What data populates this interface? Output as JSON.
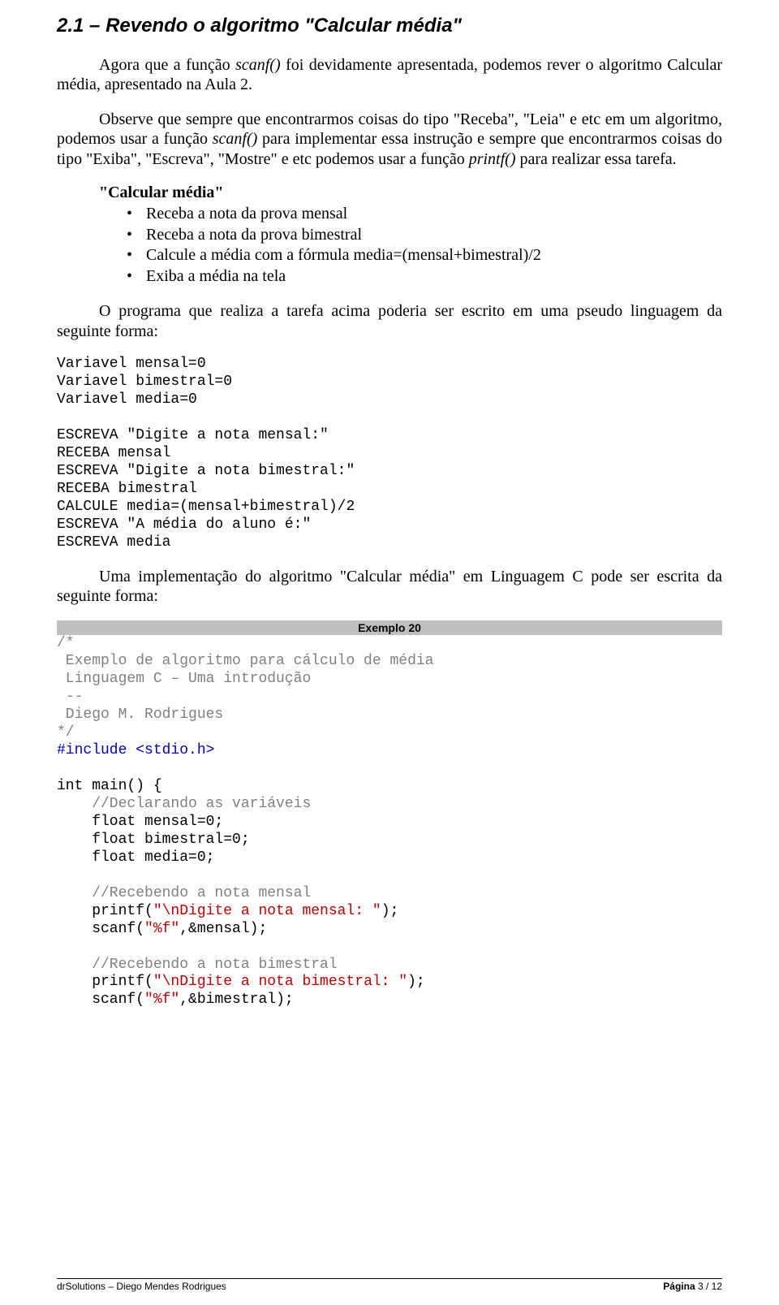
{
  "section": {
    "number": "2.1",
    "title": "Revendo o algoritmo \"Calcular média\""
  },
  "p1_a": "Agora que a função ",
  "p1_fn": "scanf()",
  "p1_b": " foi devidamente apresentada, podemos rever o algoritmo Calcular média, apresentado na Aula 2.",
  "p2_a": "Observe que sempre que encontrarmos coisas do tipo \"Receba\", \"Leia\" e etc em um algoritmo, podemos usar a função ",
  "p2_fn1": "scanf()",
  "p2_b": " para implementar essa instrução e sempre que encontrarmos coisas do tipo \"Exiba\", \"Escreva\", \"Mostre\" e etc podemos usar a função ",
  "p2_fn2": "printf()",
  "p2_c": " para realizar essa tarefa.",
  "algo_title": "\"Calcular média\"",
  "bullets": {
    "b1": "Receba a nota da prova mensal",
    "b2": "Receba a nota da prova bimestral",
    "b3": "Calcule a média com a fórmula media=(mensal+bimestral)/2",
    "b4": "Exiba a média na tela"
  },
  "p3": "O programa que realiza a tarefa acima poderia ser escrito em uma pseudo linguagem da seguinte forma:",
  "pseudo": {
    "l1": "Variavel mensal=0",
    "l2": "Variavel bimestral=0",
    "l3": "Variavel media=0",
    "l4": "ESCREVA \"Digite a nota mensal:\"",
    "l5": "RECEBA mensal",
    "l6": "ESCREVA \"Digite a nota bimestral:\"",
    "l7": "RECEBA bimestral",
    "l8": "CALCULE media=(mensal+bimestral)/2",
    "l9": "ESCREVA \"A média do aluno é:\"",
    "l10": "ESCREVA media"
  },
  "p4": "Uma implementação do algoritmo \"Calcular média\" em Linguagem C pode ser escrita da seguinte forma:",
  "example_label": "Exemplo 20",
  "code": {
    "c1": "/*",
    "c2": " Exemplo de algoritmo para cálculo de média",
    "c3": " Linguagem C – Uma introdução",
    "c4": " --",
    "c5": " Diego M. Rodrigues",
    "c6": "*/",
    "c7": "#include <stdio.h>",
    "c8": "int main() {",
    "c9": "    //Declarando as variáveis",
    "c10": "    float mensal=0;",
    "c11": "    float bimestral=0;",
    "c12": "    float media=0;",
    "c13": "    //Recebendo a nota mensal",
    "c14a": "    printf(",
    "c14b": "\"\\nDigite a nota mensal: \"",
    "c14c": ");",
    "c15a": "    scanf(",
    "c15b": "\"%f\"",
    "c15c": ",&mensal);",
    "c16": "    //Recebendo a nota bimestral",
    "c17a": "    printf(",
    "c17b": "\"\\nDigite a nota bimestral: \"",
    "c17c": ");",
    "c18a": "    scanf(",
    "c18b": "\"%f\"",
    "c18c": ",&bimestral);"
  },
  "footer": {
    "left": "drSolutions – Diego Mendes Rodrigues",
    "right_label": "Página ",
    "right_value": "3 / 12"
  }
}
